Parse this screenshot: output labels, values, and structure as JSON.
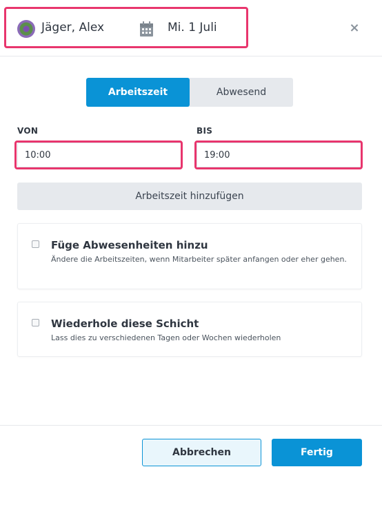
{
  "header": {
    "employee_name": "Jäger, Alex",
    "date": "Mi. 1 Juli",
    "avatar_icon": "avatar-flower-photo",
    "calendar_icon": "calendar-icon",
    "close_label": "×"
  },
  "mode_toggle": {
    "options": [
      "Arbeitszeit",
      "Abwesend"
    ],
    "selected": "Arbeitszeit"
  },
  "time": {
    "from_label": "VON",
    "from_value": "10:00",
    "to_label": "BIS",
    "to_value": "19:00"
  },
  "add_worktime_label": "Arbeitszeit hinzufügen",
  "options": [
    {
      "title": "Füge Abwesenheiten hinzu",
      "description": "Ändere die Arbeitszeiten, wenn Mitarbeiter später anfangen oder eher gehen.",
      "checked": false
    },
    {
      "title": "Wiederhole diese Schicht",
      "description": "Lass dies zu verschiedenen Tagen oder Wochen wiederholen",
      "checked": false
    }
  ],
  "footer": {
    "cancel_label": "Abbrechen",
    "done_label": "Fertig"
  },
  "colors": {
    "accent": "#0a93d6",
    "highlight": "#e8356d",
    "neutral_button": "#e6e9ed"
  }
}
